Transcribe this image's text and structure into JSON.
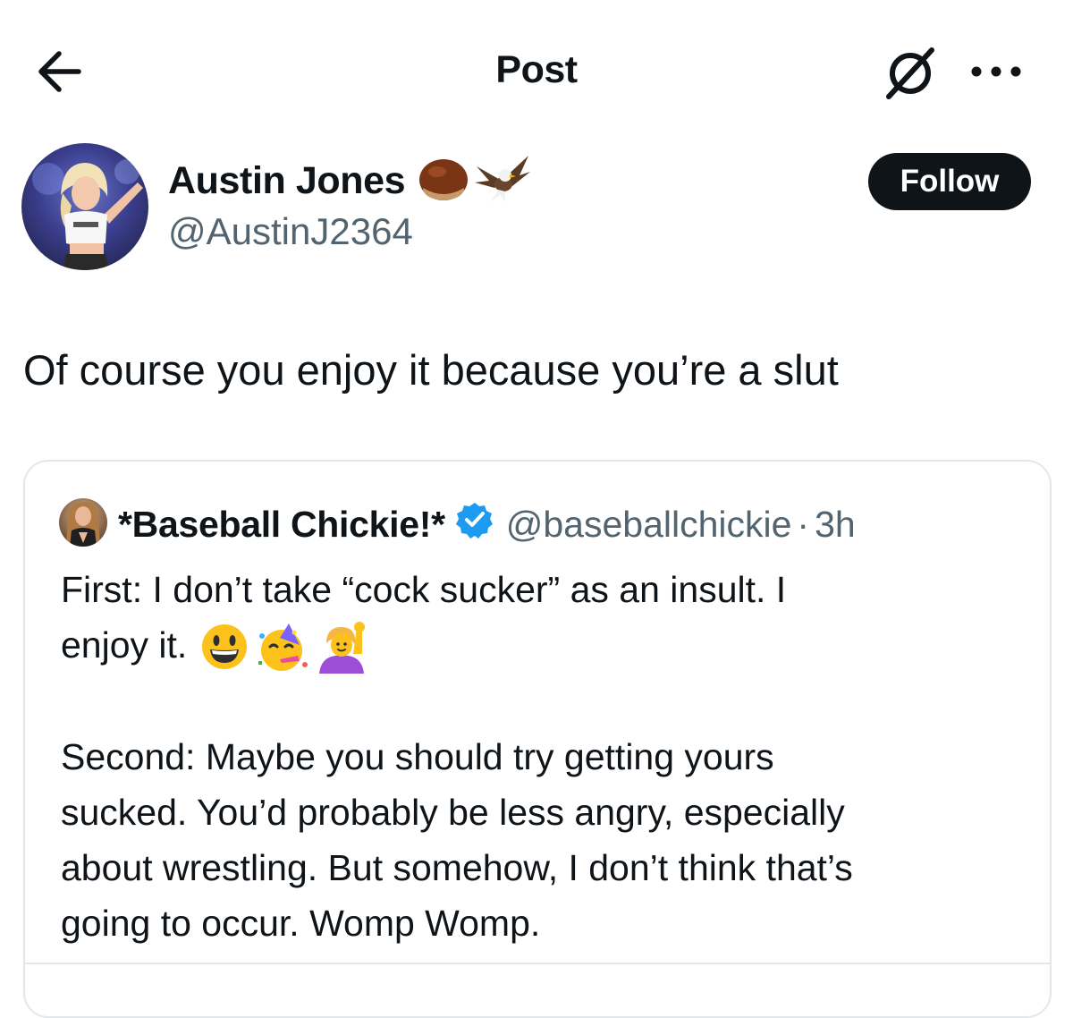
{
  "header": {
    "title": "Post",
    "back_icon": "arrow-left-icon",
    "grok_icon": "grok-icon",
    "more_icon": "more-horizontal-icon"
  },
  "author": {
    "name": "Austin Jones",
    "name_emojis": [
      "chestnut",
      "eagle"
    ],
    "handle": "@AustinJ2364",
    "follow_label": "Follow"
  },
  "post": {
    "text": "Of course you enjoy it because you’re a slut"
  },
  "quoted_post": {
    "name": "*Baseball Chickie!*",
    "verified": true,
    "handle": "@baseballchickie",
    "separator": "·",
    "time": "3h",
    "line1": "First: I don’t take “cock sucker” as an insult. I",
    "line2": "enjoy it.",
    "emojis": [
      "grinning-face",
      "partying-face",
      "person-raising-hand"
    ],
    "para2_line1": "Second: Maybe you should try getting yours",
    "para2_line2": "sucked. You’d probably be less angry, especially",
    "para2_line3": "about wrestling. But somehow, I don’t think that’s",
    "para2_line4": "going to occur. Womp Womp."
  },
  "colors": {
    "text": "#0f1419",
    "secondary": "#536471",
    "border": "#e1e8ed",
    "verified": "#1d9bf0",
    "follow_bg": "#0f1419"
  }
}
